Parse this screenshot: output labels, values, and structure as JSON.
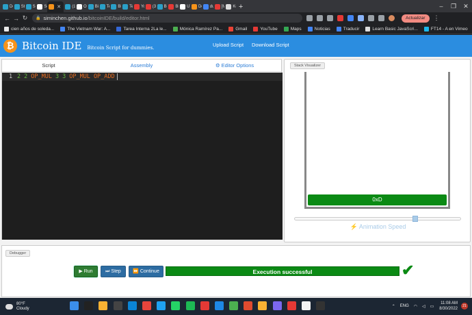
{
  "browser": {
    "tabs": [
      {
        "label": "De",
        "color": "#2aa0c8"
      },
      {
        "label": "Stu",
        "color": "#2aa0c8"
      },
      {
        "label": "Sci",
        "color": "#2aa0c8"
      },
      {
        "label": "Sci",
        "color": "#ffffff"
      },
      {
        "label": "",
        "color": "#f7931a",
        "active": true
      },
      {
        "label": "(1)",
        "color": "#2aa0c8"
      },
      {
        "label": "Or",
        "color": "#ffffff"
      },
      {
        "label": "Bit",
        "color": "#2aa0c8"
      },
      {
        "label": "Ter",
        "color": "#2aa0c8"
      },
      {
        "label": "Bit",
        "color": "#2aa0c8"
      },
      {
        "label": "Ter",
        "color": "#2aa0c8"
      },
      {
        "label": "Yo",
        "color": "#e53935"
      },
      {
        "label": "(3)",
        "color": "#e53935"
      },
      {
        "label": "Be",
        "color": "#2aa0c8"
      },
      {
        "label": "Bit",
        "color": "#e53935"
      },
      {
        "label": "UT",
        "color": "#ffffff"
      },
      {
        "label": "Dc",
        "color": "#f7931a"
      },
      {
        "label": "du",
        "color": "#4285f4"
      },
      {
        "label": "[M",
        "color": "#e53935"
      },
      {
        "label": "Ke",
        "color": "#dddddd"
      }
    ],
    "url_host": "siminchen.github.io",
    "url_path": "/bitcoinIDE/build/editor.html",
    "update_label": "Actualizar",
    "bookmarks": [
      {
        "label": "cien años de soleda...",
        "color": "#e8e8e8"
      },
      {
        "label": "The Vietnam War: A...",
        "color": "#4285f4"
      },
      {
        "label": "Tarea Interna 2La le...",
        "color": "#3367d6"
      },
      {
        "label": "Mónica Ramírez Pa...",
        "color": "#4caf50"
      },
      {
        "label": "Gmail",
        "color": "#ea4335"
      },
      {
        "label": "YouTube",
        "color": "#e53935"
      },
      {
        "label": "Maps",
        "color": "#34a853"
      },
      {
        "label": "Noticias",
        "color": "#4285f4"
      },
      {
        "label": "Traducir",
        "color": "#4285f4"
      },
      {
        "label": "Learn Basic JavaScri...",
        "color": "#dddddd"
      },
      {
        "label": "FT14 - A en Vimeo",
        "color": "#1ab7ea"
      }
    ]
  },
  "app": {
    "logo_glyph": "₿",
    "title": "Bitcoin IDE",
    "tagline": "Bitcoin Script for dummies.",
    "nav": {
      "upload": "Upload Script",
      "download": "Download Script"
    },
    "tabs": {
      "script": "Script",
      "assembly": "Assembly",
      "options": "⚙ Editor Options"
    },
    "editor": {
      "line_number": "1",
      "tokens": [
        {
          "text": "2",
          "kind": "num"
        },
        {
          "text": "2",
          "kind": "num"
        },
        {
          "text": "OP_MUL",
          "kind": "op"
        },
        {
          "text": "3",
          "kind": "num"
        },
        {
          "text": "3",
          "kind": "num"
        },
        {
          "text": "OP_MUL",
          "kind": "op"
        },
        {
          "text": "OP_ADD",
          "kind": "op"
        }
      ]
    },
    "visualizer": {
      "label": "Stack Visualizer",
      "stack_items": [
        "0xD"
      ],
      "speed_label": "⚡ Animation Speed",
      "speed_value": 0.73
    },
    "debugger": {
      "label": "Debugger",
      "run": "▶ Run",
      "step": "⏭ Step",
      "continue": "⏩ Continue",
      "status": "Execution successful",
      "status_color": "#0b8a14"
    }
  },
  "taskbar": {
    "weather_temp": "80°F",
    "weather_desc": "Cloudy",
    "apps": [
      "#3b8eea",
      "#222222",
      "#f9b233",
      "#444444",
      "#0a84d6",
      "#e8453c",
      "#1fa1f1",
      "#25d366",
      "#1db954",
      "#e53935",
      "#1e88e5",
      "#4caf50",
      "#e04b2f",
      "#f9b233",
      "#7b68ee",
      "#e53935",
      "#f4f4f4",
      "#333333"
    ],
    "lang": "ENG",
    "time": "11:08 AM",
    "date": "8/30/2022",
    "notifications": "21"
  }
}
